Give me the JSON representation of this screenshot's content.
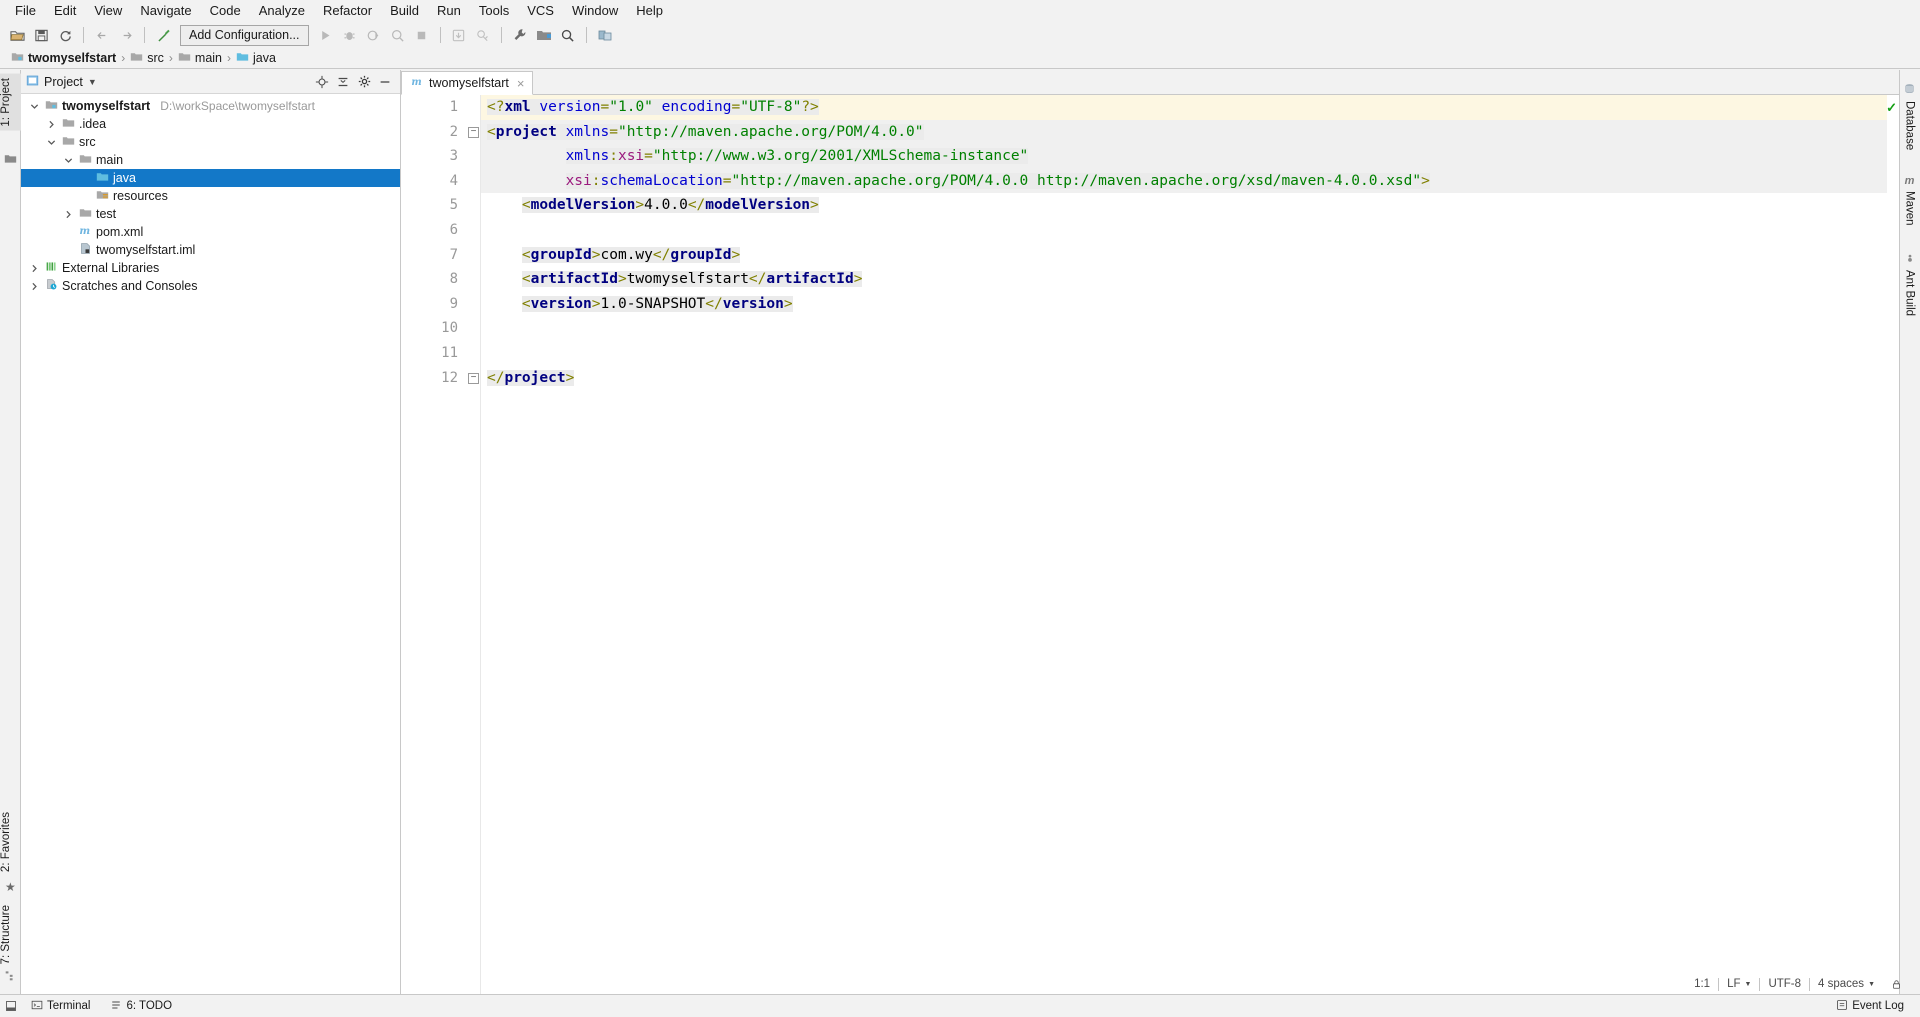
{
  "menubar": {
    "items": [
      {
        "label": "File"
      },
      {
        "label": "Edit"
      },
      {
        "label": "View"
      },
      {
        "label": "Navigate"
      },
      {
        "label": "Code"
      },
      {
        "label": "Analyze"
      },
      {
        "label": "Refactor"
      },
      {
        "label": "Build"
      },
      {
        "label": "Run"
      },
      {
        "label": "Tools"
      },
      {
        "label": "VCS"
      },
      {
        "label": "Window"
      },
      {
        "label": "Help"
      }
    ]
  },
  "toolbar": {
    "run_configuration": "Add Configuration...",
    "icons": [
      "open-folder-icon",
      "save-all-icon",
      "sync-refresh-icon",
      "back-arrow-icon",
      "forward-arrow-icon",
      "build-hammer-icon",
      "run-icon",
      "debug-icon",
      "run-with-coverage-icon",
      "profile-icon",
      "stop-icon",
      "update-project-icon",
      "commit-icon",
      "settings-wrench-icon",
      "project-structure-icon",
      "search-everywhere-icon",
      "layout-icon"
    ]
  },
  "breadcrumb": {
    "items": [
      {
        "label": "twomyselfstart",
        "icon": "module-folder-icon",
        "bold": true
      },
      {
        "label": "src",
        "icon": "folder-icon",
        "bold": false
      },
      {
        "label": "main",
        "icon": "folder-icon",
        "bold": false
      },
      {
        "label": "java",
        "icon": "source-folder-icon",
        "bold": false
      }
    ],
    "separator": "›"
  },
  "left_tool_tabs": [
    {
      "label": "1: Project",
      "active": true
    }
  ],
  "left_bottom_tabs": [
    {
      "label": "2: Favorites"
    },
    {
      "label": "7: Structure"
    }
  ],
  "right_tool_tabs": [
    {
      "label": "Database"
    },
    {
      "label": "Maven"
    },
    {
      "label": "Ant Build"
    }
  ],
  "project_panel": {
    "title": "Project",
    "title_icon": "project-view-icon",
    "dropdown_icon": "chevron-down-icon",
    "actions": [
      "locate-target-icon",
      "collapse-all-icon",
      "settings-gear-icon",
      "hide-minus-icon"
    ],
    "tree": [
      {
        "label": "twomyselfstart",
        "path": "D:\\workSpace\\twomyselfstart",
        "depth": 0,
        "arrow": "down",
        "icon": "module-folder-icon",
        "bold": true,
        "selected": false
      },
      {
        "label": ".idea",
        "path": "",
        "depth": 1,
        "arrow": "right",
        "icon": "folder-icon",
        "bold": false,
        "selected": false
      },
      {
        "label": "src",
        "path": "",
        "depth": 1,
        "arrow": "down",
        "icon": "folder-icon",
        "bold": false,
        "selected": false
      },
      {
        "label": "main",
        "path": "",
        "depth": 2,
        "arrow": "down",
        "icon": "folder-icon",
        "bold": false,
        "selected": false
      },
      {
        "label": "java",
        "path": "",
        "depth": 3,
        "arrow": "none",
        "icon": "source-folder-icon",
        "bold": false,
        "selected": true
      },
      {
        "label": "resources",
        "path": "",
        "depth": 3,
        "arrow": "none",
        "icon": "resource-folder-icon",
        "bold": false,
        "selected": false
      },
      {
        "label": "test",
        "path": "",
        "depth": 2,
        "arrow": "right",
        "icon": "folder-icon",
        "bold": false,
        "selected": false
      },
      {
        "label": "pom.xml",
        "path": "",
        "depth": 2,
        "arrow": "none",
        "icon": "maven-file-icon",
        "bold": false,
        "selected": false
      },
      {
        "label": "twomyselfstart.iml",
        "path": "",
        "depth": 2,
        "arrow": "none",
        "icon": "iml-file-icon",
        "bold": false,
        "selected": false
      },
      {
        "label": "External Libraries",
        "path": "",
        "depth": 0,
        "arrow": "right",
        "icon": "libraries-icon",
        "bold": false,
        "selected": false
      },
      {
        "label": "Scratches and Consoles",
        "path": "",
        "depth": 0,
        "arrow": "right",
        "icon": "scratches-icon",
        "bold": false,
        "selected": false
      }
    ]
  },
  "editor": {
    "tabs": [
      {
        "label": "twomyselfstart",
        "icon": "maven-file-icon",
        "close": "×",
        "active": true
      }
    ],
    "inspection_status": "ok-check-icon",
    "line_numbers": [
      1,
      2,
      3,
      4,
      5,
      6,
      7,
      8,
      9,
      10,
      11,
      12
    ],
    "folds": [
      {
        "line": 2,
        "glyph": "−"
      },
      {
        "line": 12,
        "glyph": "−"
      }
    ],
    "code_lines": [
      {
        "n": 1,
        "current": true,
        "highlight": false,
        "indent": 0,
        "tokens": [
          {
            "t": "&lt;?",
            "c": "tok-brk"
          },
          {
            "t": "xml",
            "c": "tok-pi"
          },
          {
            "t": " ",
            "c": "tok-txt"
          },
          {
            "t": "version",
            "c": "tok-attr"
          },
          {
            "t": "=",
            "c": "tok-brk"
          },
          {
            "t": "\"1.0\"",
            "c": "tok-str"
          },
          {
            "t": " ",
            "c": "tok-txt"
          },
          {
            "t": "encoding",
            "c": "tok-attr"
          },
          {
            "t": "=",
            "c": "tok-brk"
          },
          {
            "t": "\"UTF-8\"",
            "c": "tok-str"
          },
          {
            "t": "?&gt;",
            "c": "tok-brk"
          }
        ]
      },
      {
        "n": 2,
        "current": false,
        "highlight": true,
        "indent": 0,
        "tokens": [
          {
            "t": "&lt;",
            "c": "tok-brk"
          },
          {
            "t": "project",
            "c": "tok-tag"
          },
          {
            "t": " ",
            "c": "tok-txt"
          },
          {
            "t": "xmlns",
            "c": "tok-attr"
          },
          {
            "t": "=",
            "c": "tok-brk"
          },
          {
            "t": "\"http://maven.apache.org/POM/4.0.0\"",
            "c": "tok-str"
          }
        ]
      },
      {
        "n": 3,
        "current": false,
        "highlight": true,
        "indent": 9,
        "tokens": [
          {
            "t": "xmlns",
            "c": "tok-attr"
          },
          {
            "t": ":",
            "c": "tok-brk"
          },
          {
            "t": "xsi",
            "c": "tok-attrns"
          },
          {
            "t": "=",
            "c": "tok-brk"
          },
          {
            "t": "\"http://www.w3.org/2001/XMLSchema-instance\"",
            "c": "tok-str"
          }
        ]
      },
      {
        "n": 4,
        "current": false,
        "highlight": true,
        "indent": 9,
        "tokens": [
          {
            "t": "xsi",
            "c": "tok-attrns"
          },
          {
            "t": ":",
            "c": "tok-brk"
          },
          {
            "t": "schemaLocation",
            "c": "tok-attr"
          },
          {
            "t": "=",
            "c": "tok-brk"
          },
          {
            "t": "\"http://maven.apache.org/POM/4.0.0 http://maven.apache.org/xsd/maven-4.0.0.xsd\"",
            "c": "tok-str"
          },
          {
            "t": "&gt;",
            "c": "tok-brk"
          }
        ]
      },
      {
        "n": 5,
        "current": false,
        "highlight": false,
        "indent": 4,
        "tokens": [
          {
            "t": "&lt;",
            "c": "tok-brk"
          },
          {
            "t": "modelVersion",
            "c": "tok-tag"
          },
          {
            "t": "&gt;",
            "c": "tok-brk"
          },
          {
            "t": "4.0.0",
            "c": "tok-txt"
          },
          {
            "t": "&lt;/",
            "c": "tok-brk"
          },
          {
            "t": "modelVersion",
            "c": "tok-tag"
          },
          {
            "t": "&gt;",
            "c": "tok-brk"
          }
        ]
      },
      {
        "n": 6,
        "current": false,
        "highlight": false,
        "indent": 0,
        "tokens": []
      },
      {
        "n": 7,
        "current": false,
        "highlight": false,
        "indent": 4,
        "tokens": [
          {
            "t": "&lt;",
            "c": "tok-brk"
          },
          {
            "t": "groupId",
            "c": "tok-tag"
          },
          {
            "t": "&gt;",
            "c": "tok-brk"
          },
          {
            "t": "com.wy",
            "c": "tok-txt"
          },
          {
            "t": "&lt;/",
            "c": "tok-brk"
          },
          {
            "t": "groupId",
            "c": "tok-tag"
          },
          {
            "t": "&gt;",
            "c": "tok-brk"
          }
        ]
      },
      {
        "n": 8,
        "current": false,
        "highlight": false,
        "indent": 4,
        "tokens": [
          {
            "t": "&lt;",
            "c": "tok-brk"
          },
          {
            "t": "artifactId",
            "c": "tok-tag"
          },
          {
            "t": "&gt;",
            "c": "tok-brk"
          },
          {
            "t": "twomyselfstart",
            "c": "tok-txt"
          },
          {
            "t": "&lt;/",
            "c": "tok-brk"
          },
          {
            "t": "artifactId",
            "c": "tok-tag"
          },
          {
            "t": "&gt;",
            "c": "tok-brk"
          }
        ]
      },
      {
        "n": 9,
        "current": false,
        "highlight": false,
        "indent": 4,
        "tokens": [
          {
            "t": "&lt;",
            "c": "tok-brk"
          },
          {
            "t": "version",
            "c": "tok-tag"
          },
          {
            "t": "&gt;",
            "c": "tok-brk"
          },
          {
            "t": "1.0-SNAPSHOT",
            "c": "tok-txt"
          },
          {
            "t": "&lt;/",
            "c": "tok-brk"
          },
          {
            "t": "version",
            "c": "tok-tag"
          },
          {
            "t": "&gt;",
            "c": "tok-brk"
          }
        ]
      },
      {
        "n": 10,
        "current": false,
        "highlight": false,
        "indent": 0,
        "tokens": []
      },
      {
        "n": 11,
        "current": false,
        "highlight": false,
        "indent": 0,
        "tokens": []
      },
      {
        "n": 12,
        "current": false,
        "highlight": false,
        "indent": 0,
        "tokens": [
          {
            "t": "&lt;/",
            "c": "tok-brk"
          },
          {
            "t": "project",
            "c": "tok-tag"
          },
          {
            "t": "&gt;",
            "c": "tok-brk"
          }
        ]
      }
    ]
  },
  "statusbar": {
    "left": [
      {
        "label": "Terminal",
        "icon": "terminal-icon"
      },
      {
        "label": "6: TODO",
        "icon": "todo-icon"
      }
    ],
    "right": [
      {
        "label": "Event Log",
        "icon": "event-log-icon"
      }
    ],
    "bottom_right": [
      {
        "label": "1:1"
      },
      {
        "label": "LF"
      },
      {
        "label": "UTF-8"
      },
      {
        "label": "4 spaces"
      },
      {
        "label": "lock-icon"
      }
    ]
  },
  "colors": {
    "accent": "#1378c8",
    "chrome": "#f2f2f2",
    "editor_bg": "#ffffff",
    "current_line": "#fdf7e2",
    "string": "#008000",
    "tag": "#000080",
    "attr": "#0000d0",
    "ns": "#9b1b7e"
  }
}
